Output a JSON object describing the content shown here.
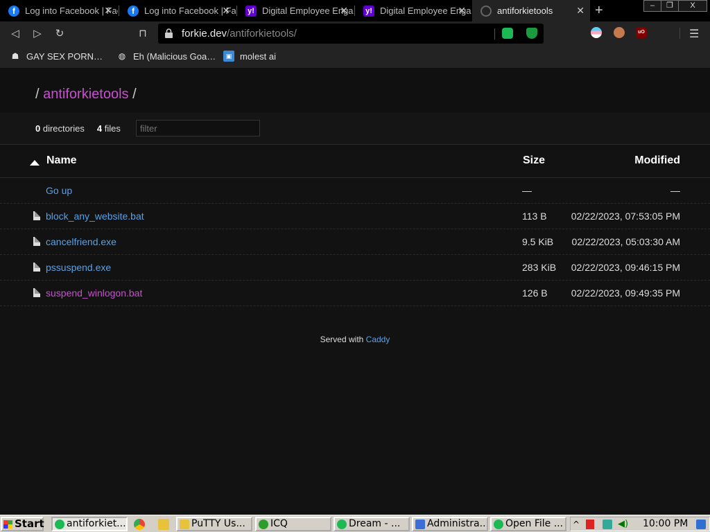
{
  "browser": {
    "tabs": [
      {
        "title": "Log into Facebook | Facebook",
        "icon": "facebook-icon",
        "active": false
      },
      {
        "title": "Log into Facebook | Facebook",
        "icon": "facebook-icon",
        "active": false
      },
      {
        "title": "Digital Employee Engagement",
        "icon": "yahoo-icon",
        "active": false
      },
      {
        "title": "Digital Employee Engagement",
        "icon": "yahoo-icon",
        "active": false
      },
      {
        "title": "antiforkietools",
        "icon": "globe-icon",
        "active": true
      }
    ],
    "new_tab_label": "+",
    "window_controls": {
      "minimize": "–",
      "restore": "❐",
      "close": "X"
    },
    "address": {
      "host": "forkie.dev",
      "path": "/antiforkietools/"
    },
    "bookmarks": [
      {
        "label": "GAY SEX PORN…",
        "icon": "ghost-icon"
      },
      {
        "label": "Eh (Malicious Goa…",
        "icon": "globe-icon"
      },
      {
        "label": "molest ai",
        "icon": "app-icon"
      }
    ]
  },
  "listing": {
    "breadcrumb": {
      "root_sep": "/",
      "folder": "antiforkietools",
      "trail_sep": "/"
    },
    "summary": {
      "dir_count": "0",
      "dir_label": "directories",
      "file_count": "4",
      "file_label": "files"
    },
    "filter_placeholder": "filter",
    "columns": {
      "name": "Name",
      "size": "Size",
      "modified": "Modified"
    },
    "go_up": {
      "label": "Go up",
      "size": "—",
      "modified": "—"
    },
    "files": [
      {
        "name": "block_any_website.bat",
        "size": "113 B",
        "modified": "02/22/2023, 07:53:05 PM",
        "visited": false
      },
      {
        "name": "cancelfriend.exe",
        "size": "9.5 KiB",
        "modified": "02/22/2023, 05:03:30 AM",
        "visited": false
      },
      {
        "name": "pssuspend.exe",
        "size": "283 KiB",
        "modified": "02/22/2023, 09:46:15 PM",
        "visited": false
      },
      {
        "name": "suspend_winlogon.bat",
        "size": "126 B",
        "modified": "02/22/2023, 09:49:35 PM",
        "visited": true
      }
    ],
    "footer": {
      "prefix": "Served with",
      "link": "Caddy"
    }
  },
  "taskbar": {
    "start_label": "Start",
    "buttons": [
      {
        "label": "antiforkiet...",
        "color": "#1db954"
      },
      {
        "label": "PuTTY Us...",
        "color": "#e8c23a"
      },
      {
        "label": "ICQ",
        "color": "#2a9d2a"
      },
      {
        "label": "Dream - ...",
        "color": "#1db954"
      },
      {
        "label": "Administra...",
        "color": "#3a6fd8"
      },
      {
        "label": "Open File ...",
        "color": "#1db954"
      }
    ],
    "clock": "10:00 PM",
    "tray_expand": "^"
  },
  "colors": {
    "link": "#5aa0e6",
    "visited_link": "#c94fd0",
    "page_bg": "#121212",
    "taskbar_bg": "#d4d0c8"
  }
}
